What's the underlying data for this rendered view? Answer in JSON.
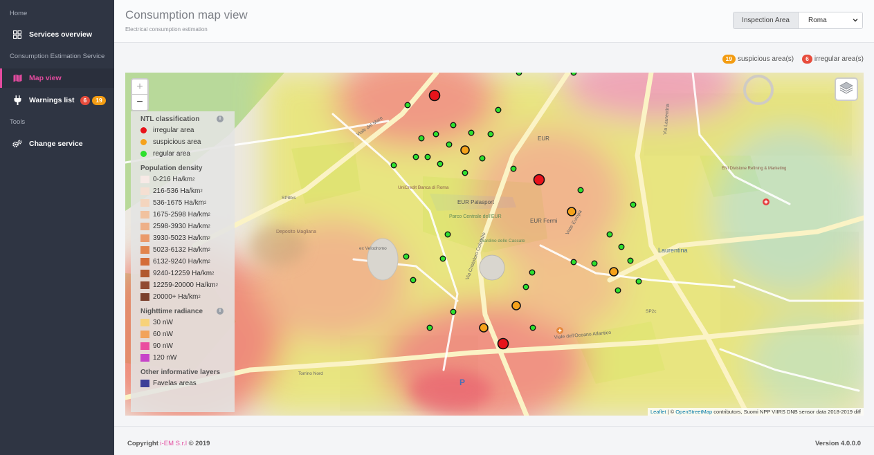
{
  "sidebar": {
    "sections": [
      "Home",
      "Consumption Estimation Service",
      "Tools"
    ],
    "items": [
      {
        "label": "Services overview",
        "icon": "grid-icon"
      },
      {
        "label": "Map view",
        "icon": "map-icon"
      },
      {
        "label": "Warnings list",
        "icon": "plug-icon",
        "badges": [
          "6",
          "19"
        ]
      },
      {
        "label": "Change service",
        "icon": "gears-icon"
      }
    ]
  },
  "header": {
    "title": "Consumption map view",
    "subtitle": "Electrical consumption estimation",
    "area_label": "Inspection Area",
    "area_value": "Roma"
  },
  "counters": {
    "suspicious_count": "19",
    "suspicious_label": "suspicious area(s)",
    "irregular_count": "6",
    "irregular_label": "irregular area(s)"
  },
  "map": {
    "zoom_in": "+",
    "zoom_out": "−",
    "place_labels": [
      "EUR Palasport",
      "EUR Fermi",
      "EUR",
      "Parco Centrale dell'EUR",
      "Laurentina",
      "UniCredit Banca di Roma",
      "Giardino delle Cascate",
      "ex Velodromo",
      "Deposito Magliana",
      "ENI Divisione Refining & Marketing",
      "Viale del Mare",
      "Viale dell'Oceano Atlantico",
      "Via Cristoforo Colombo",
      "Via Laurentina",
      "Viale Europa",
      "SP8bis",
      "SP2c",
      "Torrino Nord"
    ],
    "attribution": {
      "leaflet": "Leaflet",
      "sep": " | © ",
      "osm": "OpenStreetMap",
      "rest": " contributors, Suomi NPP VIIRS DNB sensor data 2018-2019 diff"
    },
    "markers": {
      "irregular": [
        [
          447,
          33
        ],
        [
          598,
          155
        ],
        [
          546,
          392
        ]
      ],
      "suspicious": [
        [
          491,
          112
        ],
        [
          645,
          201
        ],
        [
          706,
          288
        ],
        [
          565,
          337
        ],
        [
          518,
          369
        ]
      ],
      "regular": [
        [
          569,
          0
        ],
        [
          648,
          0
        ],
        [
          408,
          47
        ],
        [
          539,
          54
        ],
        [
          474,
          76
        ],
        [
          500,
          87
        ],
        [
          528,
          89
        ],
        [
          449,
          89
        ],
        [
          428,
          95
        ],
        [
          468,
          104
        ],
        [
          420,
          122
        ],
        [
          437,
          122
        ],
        [
          455,
          132
        ],
        [
          516,
          124
        ],
        [
          388,
          134
        ],
        [
          561,
          139
        ],
        [
          491,
          145
        ],
        [
          658,
          170
        ],
        [
          734,
          191
        ],
        [
          466,
          234
        ],
        [
          700,
          234
        ],
        [
          717,
          252
        ],
        [
          406,
          266
        ],
        [
          459,
          269
        ],
        [
          648,
          274
        ],
        [
          678,
          276
        ],
        [
          730,
          272
        ],
        [
          588,
          289
        ],
        [
          742,
          302
        ],
        [
          416,
          300
        ],
        [
          579,
          310
        ],
        [
          712,
          315
        ],
        [
          474,
          346
        ],
        [
          440,
          369
        ],
        [
          589,
          369
        ]
      ]
    },
    "colors": {
      "irregular": "#e8131b",
      "suspicious": "#f5a21b",
      "regular": "#2ee02e"
    }
  },
  "legend": {
    "ntl": {
      "title": "NTL classification",
      "items": [
        {
          "label": "irregular area",
          "color": "#e8131b"
        },
        {
          "label": "suspicious area",
          "color": "#f5a21b"
        },
        {
          "label": "regular area",
          "color": "#2ee02e"
        }
      ]
    },
    "population": {
      "title": "Population density",
      "unit_sup": "2",
      "items": [
        {
          "label": "0-216 Ha/km",
          "color": "#f7eae6"
        },
        {
          "label": "216-536 Ha/km",
          "color": "#f5dfd2"
        },
        {
          "label": "536-1675 Ha/km",
          "color": "#f4d5be"
        },
        {
          "label": "1675-2598 Ha/km",
          "color": "#f1c29f"
        },
        {
          "label": "2598-3930 Ha/km",
          "color": "#eeb088"
        },
        {
          "label": "3930-5023 Ha/km",
          "color": "#ea9a6b"
        },
        {
          "label": "5023-6132 Ha/km",
          "color": "#e2844c"
        },
        {
          "label": "6132-9240 Ha/km",
          "color": "#d46d38"
        },
        {
          "label": "9240-12259 Ha/km",
          "color": "#b1592f"
        },
        {
          "label": "12259-20000 Ha/km",
          "color": "#914a32"
        },
        {
          "label": "20000+ Ha/km",
          "color": "#7a3f2b"
        }
      ]
    },
    "radiance": {
      "title": "Nighttime radiance",
      "items": [
        {
          "label": "30 nW",
          "color": "#f7d27a"
        },
        {
          "label": "60 nW",
          "color": "#f2a35a"
        },
        {
          "label": "90 nW",
          "color": "#ea4d9f"
        },
        {
          "label": "120 nW",
          "color": "#c744c9"
        }
      ]
    },
    "other": {
      "title": "Other informative layers",
      "items": [
        {
          "label": "Favelas areas",
          "color": "#3d3f98"
        }
      ]
    }
  },
  "footer": {
    "copyright_prefix": "Copyright ",
    "company": "i-EM S.r.l",
    "copyright_suffix": " © 2019",
    "version": "Version 4.0.0.0"
  }
}
